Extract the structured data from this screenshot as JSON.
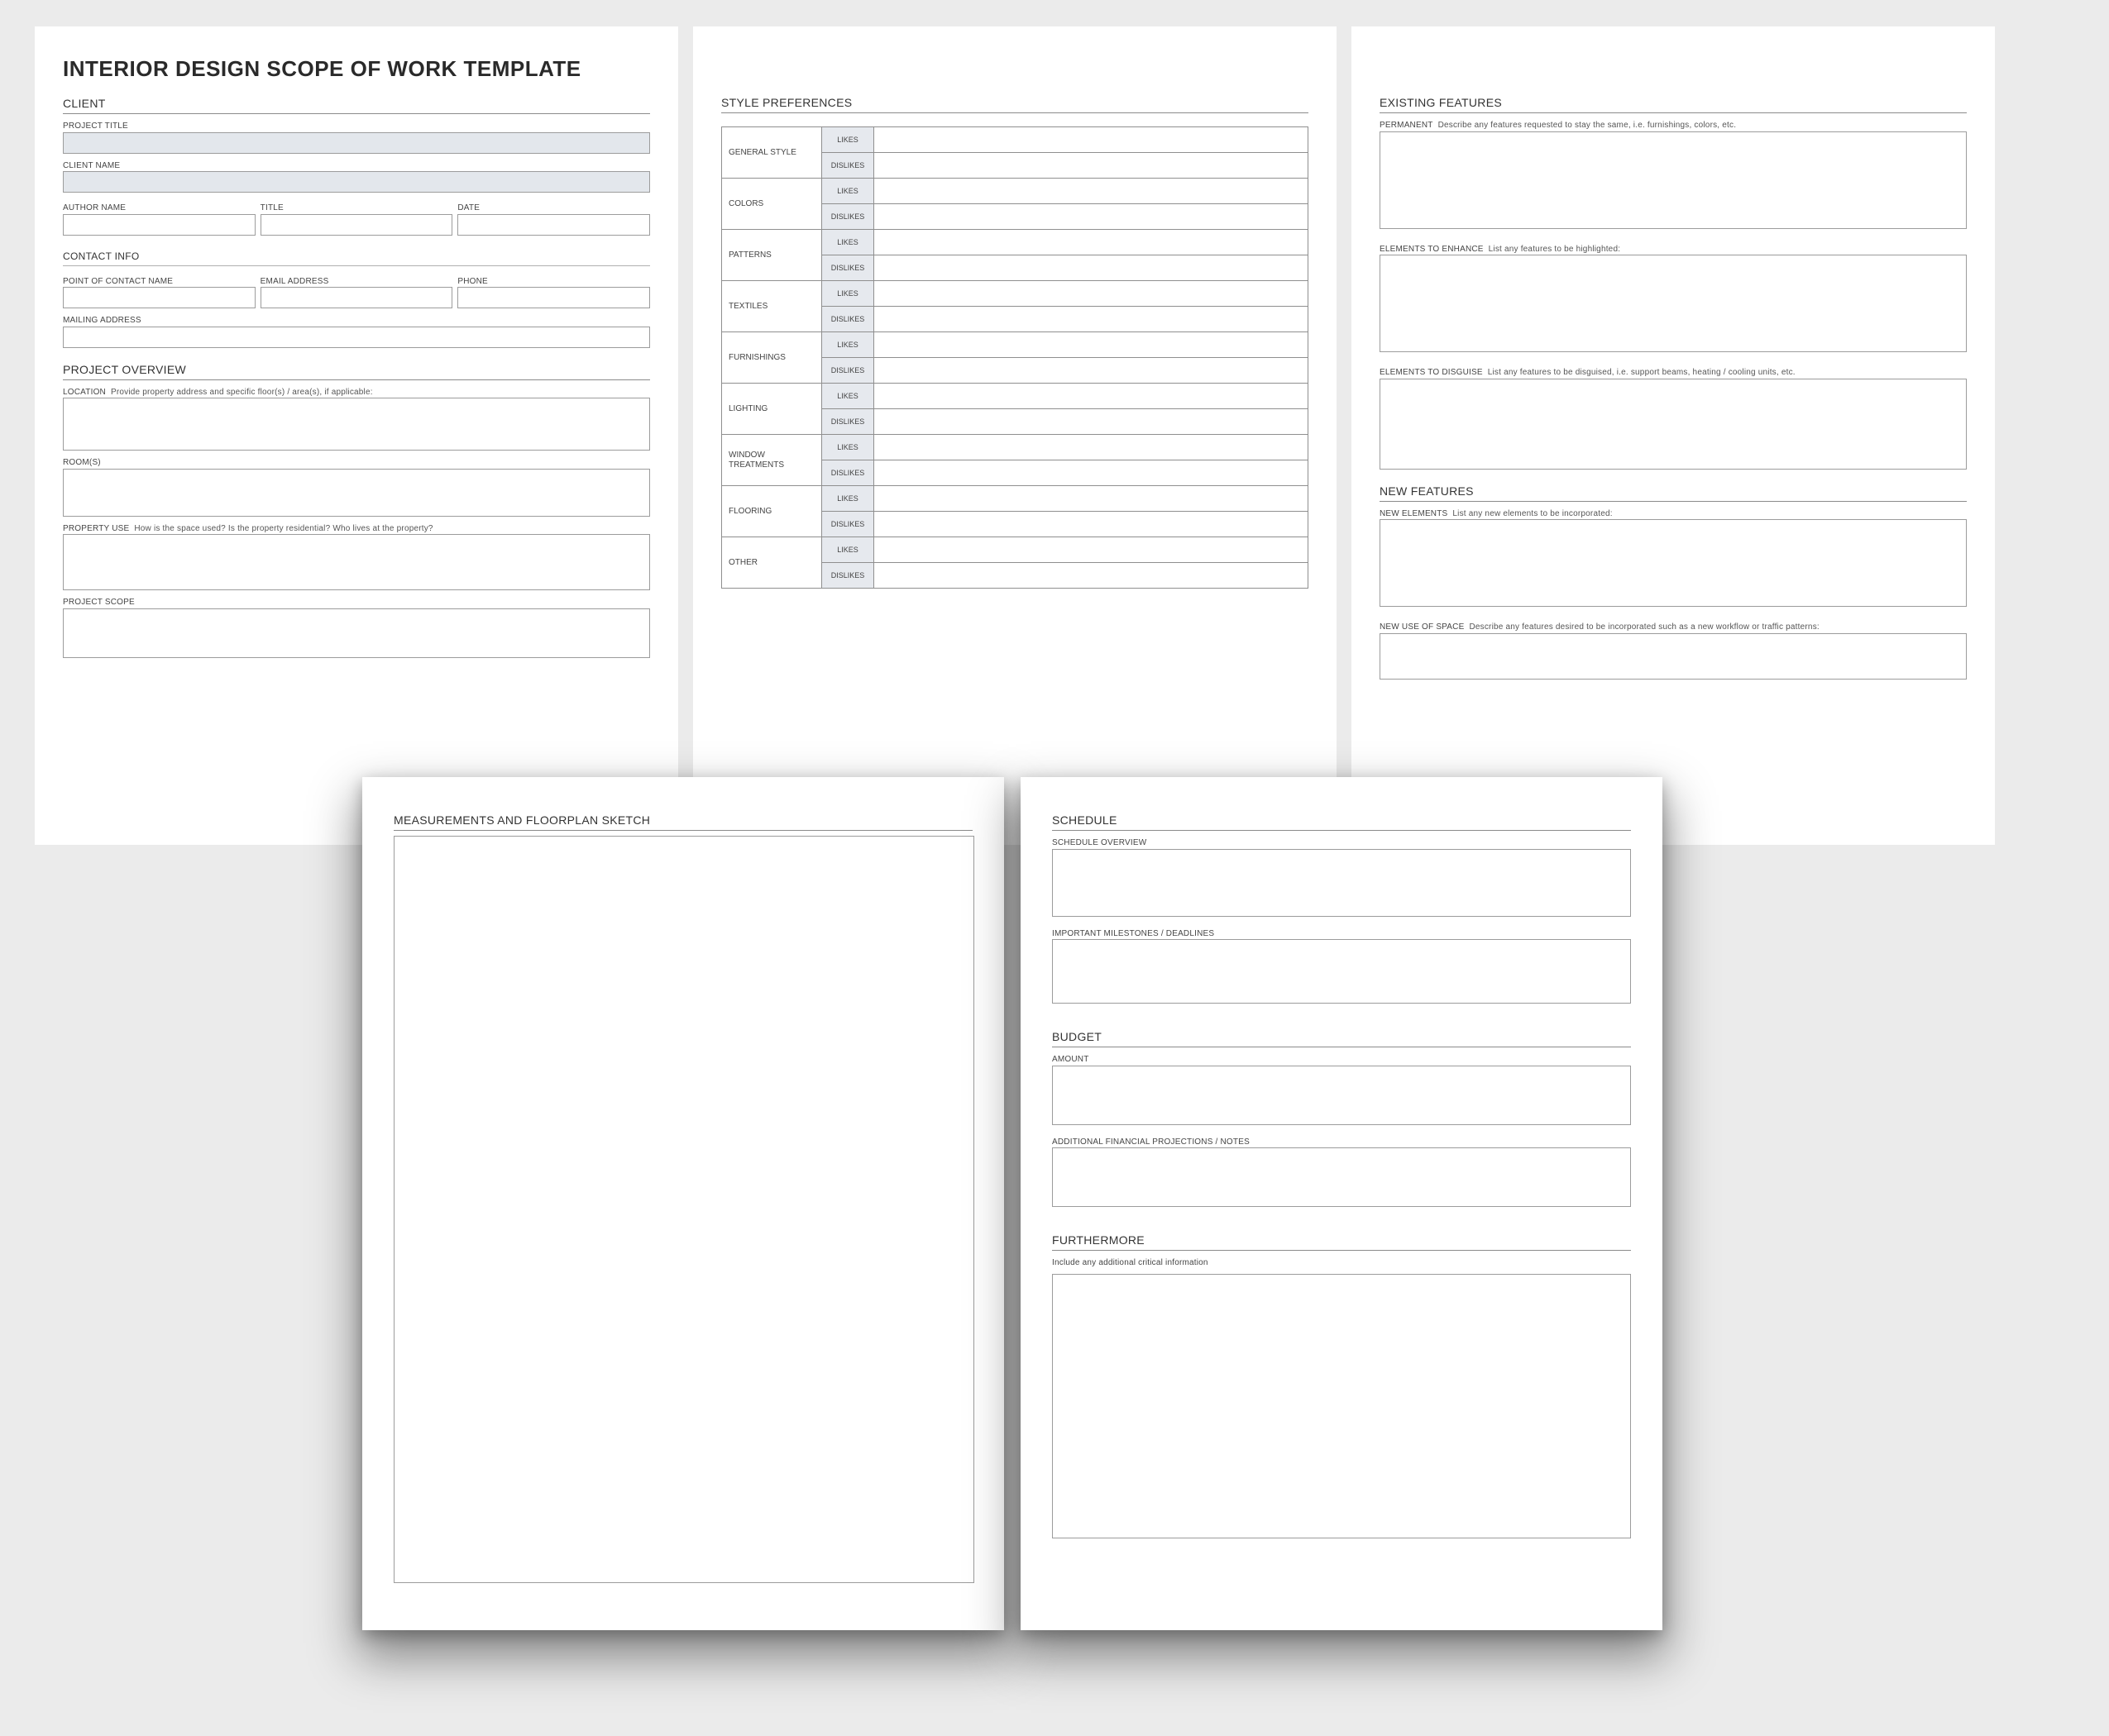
{
  "title": "INTERIOR DESIGN SCOPE OF WORK TEMPLATE",
  "page1": {
    "client_head": "CLIENT",
    "project_title_lbl": "PROJECT TITLE",
    "client_name_lbl": "CLIENT NAME",
    "author_name_lbl": "AUTHOR NAME",
    "title_lbl": "TITLE",
    "date_lbl": "DATE",
    "contact_head": "CONTACT INFO",
    "poc_lbl": "POINT OF CONTACT NAME",
    "email_lbl": "EMAIL ADDRESS",
    "phone_lbl": "PHONE",
    "mailing_lbl": "MAILING ADDRESS",
    "overview_head": "PROJECT OVERVIEW",
    "location_lbl": "LOCATION",
    "location_desc": "Provide property address and specific floor(s) / area(s), if applicable:",
    "rooms_lbl": "ROOM(S)",
    "propuse_lbl": "PROPERTY USE",
    "propuse_desc": "How is the space used?  Is the property residential? Who lives at the property?",
    "scope_lbl": "PROJECT SCOPE"
  },
  "page2": {
    "head": "STYLE PREFERENCES",
    "likes": "LIKES",
    "dislikes": "DISLIKES",
    "categories": [
      "GENERAL STYLE",
      "COLORS",
      "PATTERNS",
      "TEXTILES",
      "FURNISHINGS",
      "LIGHTING",
      "WINDOW TREATMENTS",
      "FLOORING",
      "OTHER"
    ]
  },
  "page3": {
    "exist_head": "EXISTING FEATURES",
    "perm_lbl": "PERMANENT",
    "perm_desc": "Describe any features requested to stay the same, i.e. furnishings, colors, etc.",
    "enhance_lbl": "ELEMENTS TO ENHANCE",
    "enhance_desc": "List any features to be highlighted:",
    "disguise_lbl": "ELEMENTS TO DISGUISE",
    "disguise_desc": "List any features to be disguised, i.e. support beams, heating / cooling units, etc.",
    "new_head": "NEW FEATURES",
    "newel_lbl": "NEW ELEMENTS",
    "newel_desc": "List any new elements to be incorporated:",
    "newuse_lbl": "NEW USE OF SPACE",
    "newuse_desc": "Describe any features desired to be incorporated such as a new workflow or traffic patterns:"
  },
  "page4": {
    "head": "MEASUREMENTS AND FLOORPLAN SKETCH"
  },
  "page5": {
    "sched_head": "SCHEDULE",
    "sched_over_lbl": "SCHEDULE OVERVIEW",
    "milestones_lbl": "IMPORTANT MILESTONES / DEADLINES",
    "budget_head": "BUDGET",
    "amount_lbl": "AMOUNT",
    "fin_lbl": "ADDITIONAL FINANCIAL PROJECTIONS / NOTES",
    "further_head": "FURTHERMORE",
    "further_desc": "Include any additional critical information"
  }
}
